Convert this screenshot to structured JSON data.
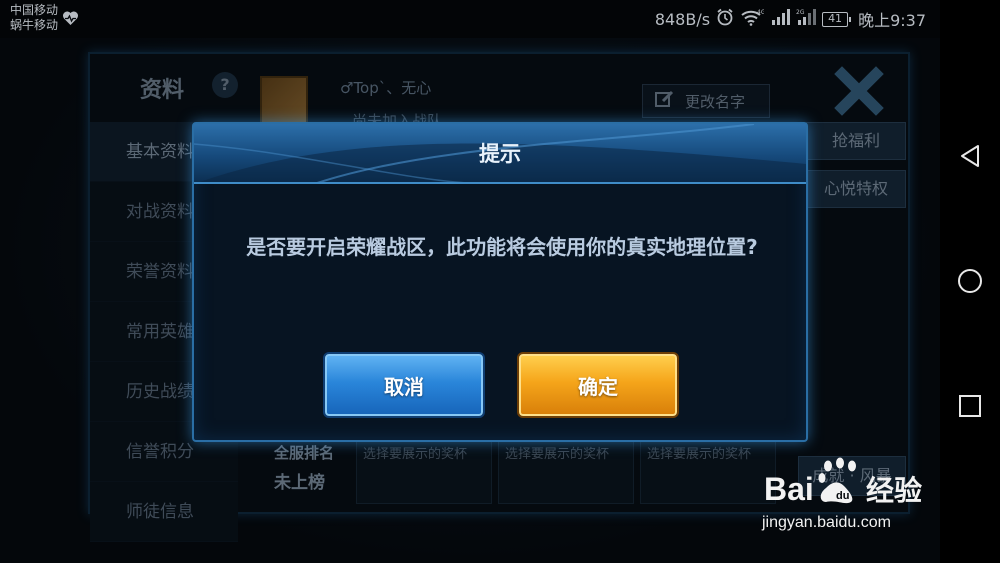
{
  "status_bar": {
    "carrier_1": "中国移动",
    "carrier_2": "蜗牛移动",
    "net_speed": "848B/s",
    "battery": "41",
    "time": "晚上9:37"
  },
  "panel": {
    "title": "资料",
    "help": "?",
    "player_name": "♂Top`、无心",
    "team_status": "尚未加入战队",
    "rename_label": "更改名字",
    "side_buttons": [
      "抢福利",
      "心悦特权"
    ],
    "sidebar_items": [
      "基本资料",
      "对战资料",
      "荣誉资料",
      "常用英雄",
      "历史战绩",
      "信誉积分",
      "师徒信息"
    ],
    "rank_label": "全服排名",
    "rank_value": "未上榜",
    "trophy_slots": [
      "选择要展示的奖杯",
      "选择要展示的奖杯",
      "选择要展示的奖杯"
    ],
    "bottom_button": "成就 · 风暴"
  },
  "dialog": {
    "title": "提示",
    "message": "是否要开启荣耀战区，此功能将会使用你的真实地理位置?",
    "cancel_label": "取消",
    "confirm_label": "确定"
  },
  "watermark": {
    "brand": "Bai百度经验",
    "url": "jingyan.baidu.com"
  },
  "colors": {
    "cancel_button": "#2a86da",
    "confirm_button": "#f5a51a",
    "dialog_header": "#1f5c93"
  },
  "icons": [
    "heart-rate-icon",
    "alarm-icon",
    "wifi-icon",
    "signal-icon",
    "battery-icon",
    "back-icon",
    "home-icon",
    "recents-icon",
    "close-icon",
    "edit-icon",
    "male-icon"
  ]
}
